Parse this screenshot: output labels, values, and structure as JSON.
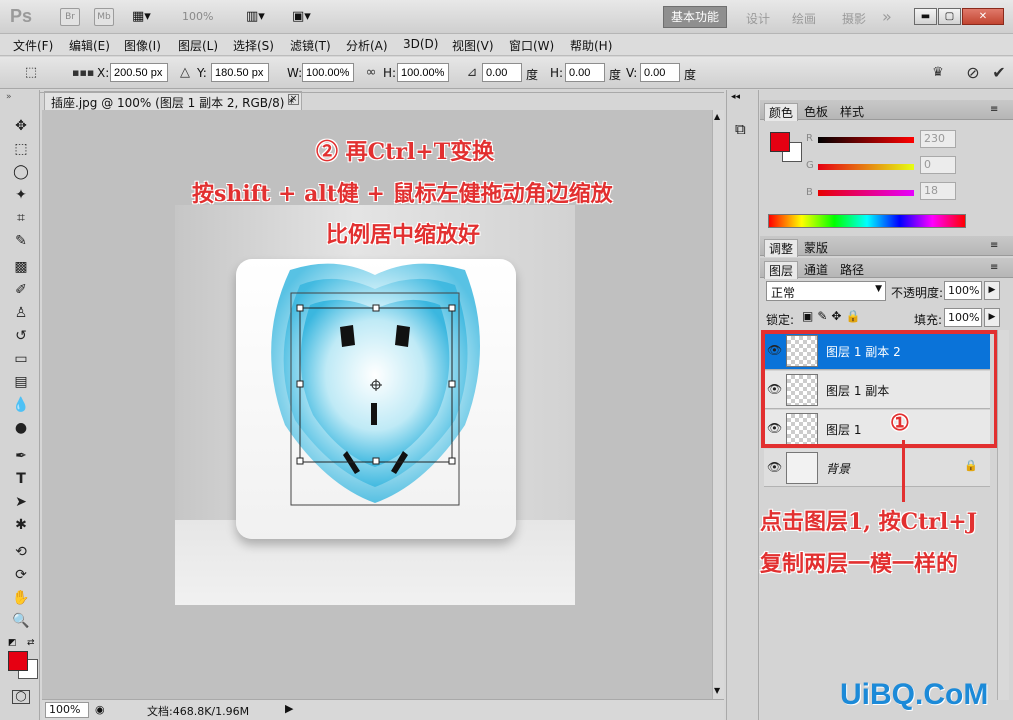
{
  "titlebar": {
    "logo": "Ps",
    "bridge": "Br",
    "minibridge": "Mb",
    "zoom": "100%",
    "workspaces": {
      "active": "基本功能",
      "design": "设计",
      "painting": "绘画",
      "photography": "摄影",
      "more": "»"
    }
  },
  "menu": [
    "文件(F)",
    "编辑(E)",
    "图像(I)",
    "图层(L)",
    "选择(S)",
    "滤镜(T)",
    "分析(A)",
    "3D(D)",
    "视图(V)",
    "窗口(W)",
    "帮助(H)"
  ],
  "options": {
    "x_label": "X:",
    "x_value": "200.50 px",
    "y_label": "Y:",
    "y_value": "180.50 px",
    "w_label": "W:",
    "w_value": "100.00%",
    "h_label": "H:",
    "h_value": "100.00%",
    "rot_value": "0.00",
    "deg1": "度",
    "hskew_label": "H:",
    "hskew_value": "0.00",
    "deg2": "度",
    "vskew_label": "V:",
    "vskew_value": "0.00",
    "deg3": "度"
  },
  "document": {
    "tab_title": "插座.jpg @ 100% (图层 1 副本 2, RGB/8) *",
    "close": "×",
    "zoom": "100%",
    "doc_info": "文档:468.8K/1.96M"
  },
  "annotations": {
    "step2_title": "② 再Ctrl+T变换",
    "step2_line1": "按shift + alt健 + 鼠标左健拖动角边缩放",
    "step2_line2": "比例居中缩放好",
    "step1_marker": "①",
    "step1_line1": "点击图层1, 按Ctrl+J",
    "step1_line2": "复制两层一模一样的"
  },
  "color_panel": {
    "tabs": [
      "颜色",
      "色板",
      "样式"
    ],
    "r_label": "R",
    "r_value": "230",
    "g_label": "G",
    "g_value": "0",
    "b_label": "B",
    "b_value": "18",
    "fg_color": "#e60012"
  },
  "adjust_panel": {
    "tabs": [
      "调整",
      "蒙版"
    ]
  },
  "layers_panel": {
    "tabs": [
      "图层",
      "通道",
      "路径"
    ],
    "blend_mode": "正常",
    "opacity_label": "不透明度:",
    "opacity_value": "100%",
    "lock_label": "锁定:",
    "fill_label": "填充:",
    "fill_value": "100%",
    "layers": [
      {
        "name": "图层 1 副本 2",
        "selected": true
      },
      {
        "name": "图层 1 副本",
        "selected": false
      },
      {
        "name": "图层 1",
        "selected": false
      },
      {
        "name": "背景",
        "selected": false
      }
    ]
  },
  "watermark": "UiBQ.CoM",
  "accent_red": "#e23030",
  "selection_blue": "#0a73d9"
}
